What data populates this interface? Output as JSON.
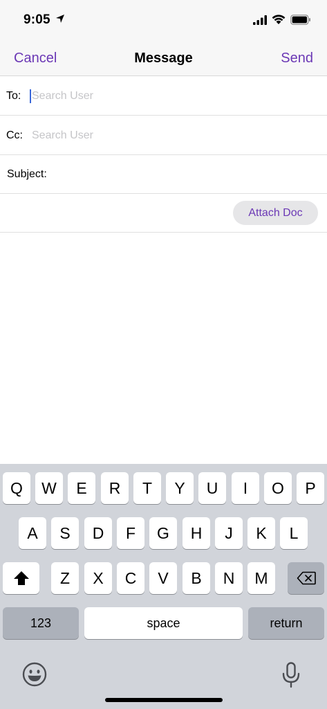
{
  "status": {
    "time": "9:05"
  },
  "nav": {
    "cancel": "Cancel",
    "title": "Message",
    "send": "Send"
  },
  "form": {
    "to_label": "To:",
    "to_placeholder": "Search User",
    "cc_label": "Cc:",
    "cc_placeholder": "Search User",
    "subject_label": "Subject:",
    "attach_label": "Attach Doc"
  },
  "keyboard": {
    "row1": [
      "Q",
      "W",
      "E",
      "R",
      "T",
      "Y",
      "U",
      "I",
      "O",
      "P"
    ],
    "row2": [
      "A",
      "S",
      "D",
      "F",
      "G",
      "H",
      "J",
      "K",
      "L"
    ],
    "row3": [
      "Z",
      "X",
      "C",
      "V",
      "B",
      "N",
      "M"
    ],
    "numbers": "123",
    "space": "space",
    "return": "return"
  },
  "colors": {
    "accent": "#6b38b5",
    "cursor": "#3a67d9",
    "keyboard_bg": "#d1d4da"
  }
}
